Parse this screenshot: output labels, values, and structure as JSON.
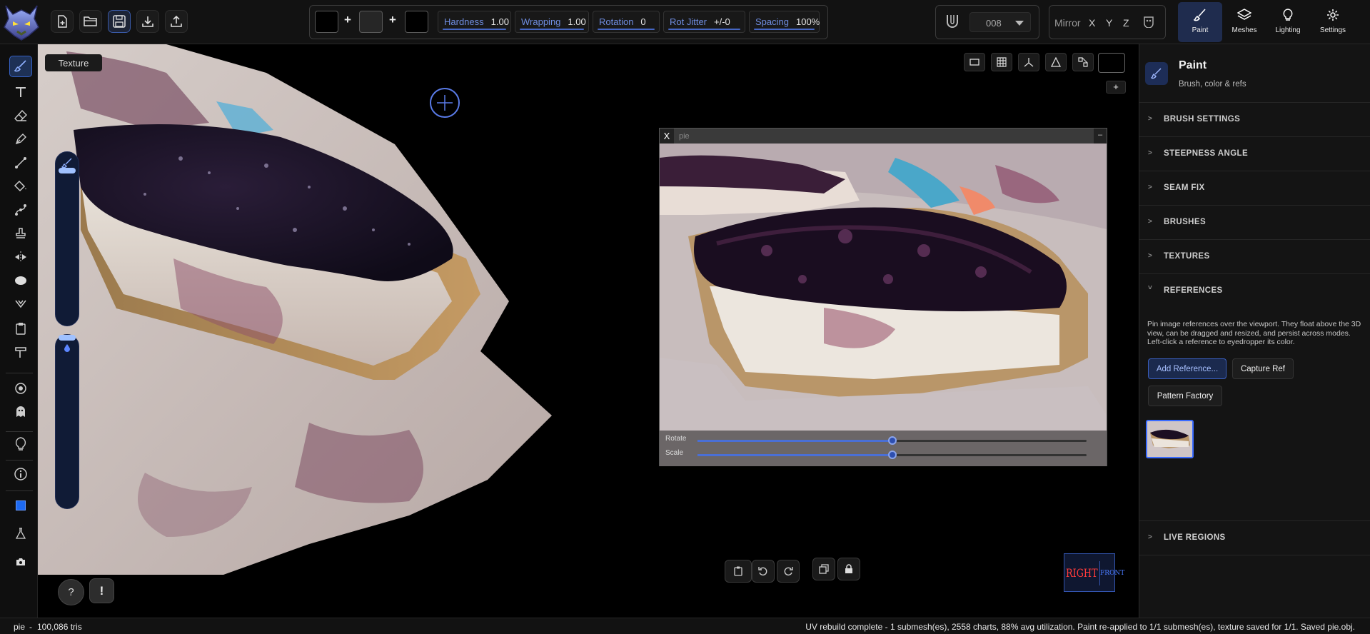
{
  "topbar": {
    "file_buttons": [
      "new-file-icon",
      "open-folder-icon",
      "save-icon",
      "import-icon",
      "export-icon"
    ],
    "params": [
      {
        "label": "Hardness",
        "value": "1.00"
      },
      {
        "label": "Wrapping",
        "value": "1.00"
      },
      {
        "label": "Rotation",
        "value": "0"
      },
      {
        "label": "Rot Jitter",
        "value": "+/-0"
      },
      {
        "label": "Spacing",
        "value": "100%"
      }
    ],
    "brush_number": "008",
    "mirror": {
      "label": "Mirror",
      "x": "X",
      "y": "Y",
      "z": "Z"
    },
    "tabs": [
      {
        "label": "Paint",
        "icon": "brush-icon"
      },
      {
        "label": "Meshes",
        "icon": "layers-icon"
      },
      {
        "label": "Lighting",
        "icon": "bulb-icon"
      },
      {
        "label": "Settings",
        "icon": "gear-icon"
      }
    ],
    "colors": {
      "accent": "#4566c4",
      "active_tab": "#1f2c4e"
    }
  },
  "viewport": {
    "tooltip": "Texture",
    "plus_label": "+",
    "help_label": "?",
    "alert_label": "!",
    "gizmo": {
      "right": "RIGHT",
      "front": "FRONT"
    }
  },
  "reference_window": {
    "close_label": "X",
    "title": "pie",
    "minimize_label": "–",
    "sliders": [
      {
        "label": "Rotate",
        "value": 0.5
      },
      {
        "label": "Scale",
        "value": 0.5
      }
    ]
  },
  "panel": {
    "title": "Paint",
    "subtitle": "Brush, color & refs",
    "sections": [
      {
        "label": "BRUSH SETTINGS",
        "chevron": ">"
      },
      {
        "label": "STEEPNESS ANGLE",
        "chevron": ">"
      },
      {
        "label": "SEAM FIX",
        "chevron": ">"
      },
      {
        "label": "BRUSHES",
        "chevron": ">"
      },
      {
        "label": "TEXTURES",
        "chevron": ">"
      },
      {
        "label": "REFERENCES",
        "chevron": "˅"
      }
    ],
    "references_description": "Pin image references over the viewport. They float above the 3D view, can be dragged and resized, and persist across modes. Left-click a reference to eyedropper its color.",
    "add_reference": "Add Reference...",
    "capture_ref": "Capture Ref",
    "pattern_factory": "Pattern Factory",
    "live_regions": {
      "label": "LIVE REGIONS",
      "chevron": ">"
    }
  },
  "status": {
    "mesh": "pie",
    "separator": "-",
    "tris": "100,086 tris",
    "message": "UV rebuild complete - 1 submesh(es), 2558 charts, 88% avg utilization. Paint re-applied to 1/1 submesh(es), texture saved for 1/1. Saved pie.obj."
  }
}
